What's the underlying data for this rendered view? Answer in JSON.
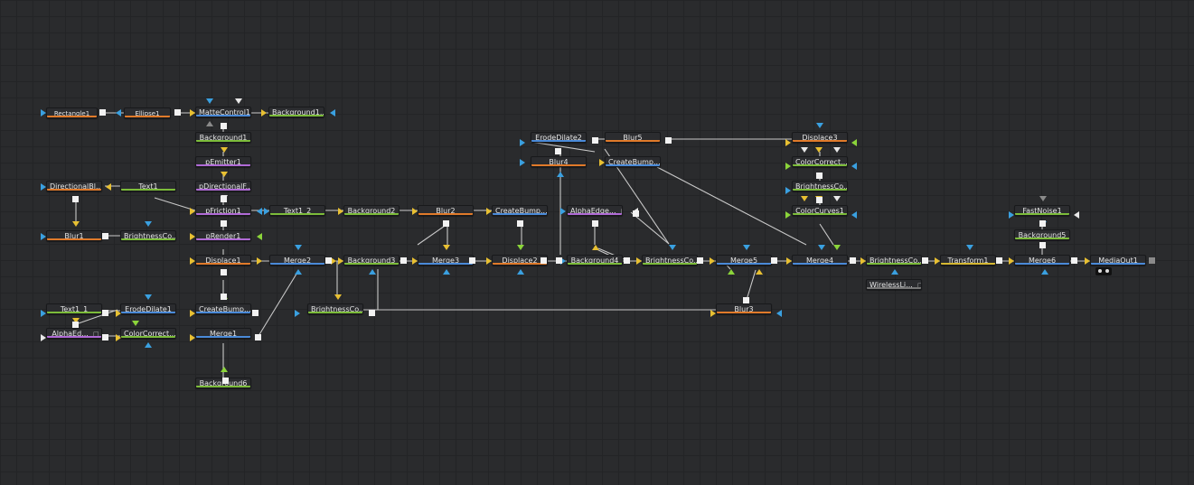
{
  "colors": {
    "background": "#2a2b2d",
    "wire": "#c9c9c9",
    "pin_blue": "#3aa0e0",
    "pin_yellow": "#e8c032",
    "pin_green": "#8bd43a",
    "pin_white": "#e8e8e8",
    "pin_grey": "#8a8a8a",
    "strip_orange": "#e07a2a",
    "strip_green": "#7cbc3a",
    "strip_purple": "#b06ad6",
    "strip_blue": "#4a8ad8",
    "strip_yellow": "#d6b832",
    "strip_red": "#c54a3a"
  },
  "nodes": [
    {
      "id": "rectangle1",
      "label": "Rectangle1",
      "type": "orange",
      "icon": ""
    },
    {
      "id": "ellipse1",
      "label": "Ellipse1",
      "type": "orange",
      "icon": ""
    },
    {
      "id": "mattecontrol1",
      "label": "MatteControl1",
      "type": "blue",
      "icon": ""
    },
    {
      "id": "background1_top",
      "label": "Background1...",
      "type": "green",
      "icon": ""
    },
    {
      "id": "background1",
      "label": "Background1",
      "type": "green",
      "icon": ""
    },
    {
      "id": "pemitter1",
      "label": "pEmitter1",
      "type": "purple",
      "icon": ""
    },
    {
      "id": "pdirectionalf",
      "label": "pDirectionalF...",
      "type": "purple",
      "icon": ""
    },
    {
      "id": "directionalbl",
      "label": "DirectionalBl...",
      "type": "orange",
      "icon": ""
    },
    {
      "id": "text1",
      "label": "Text1",
      "type": "green",
      "icon": ""
    },
    {
      "id": "pfriction1",
      "label": "pFriction1",
      "type": "purple",
      "icon": ""
    },
    {
      "id": "blur1",
      "label": "Blur1",
      "type": "orange",
      "icon": ""
    },
    {
      "id": "brightnessco1",
      "label": "BrightnessCo...",
      "type": "green",
      "icon": ""
    },
    {
      "id": "prender1",
      "label": "pRender1",
      "type": "purple",
      "icon": ""
    },
    {
      "id": "displace1",
      "label": "Displace1",
      "type": "orange",
      "icon": ""
    },
    {
      "id": "merge2",
      "label": "Merge2",
      "type": "blue",
      "icon": ""
    },
    {
      "id": "text1_2",
      "label": "Text1_2",
      "type": "green",
      "icon": ""
    },
    {
      "id": "background2",
      "label": "Background2",
      "type": "green",
      "icon": ""
    },
    {
      "id": "blur2",
      "label": "Blur2",
      "type": "orange",
      "icon": ""
    },
    {
      "id": "createbump1",
      "label": "CreateBump...",
      "type": "blue",
      "icon": ""
    },
    {
      "id": "background3",
      "label": "Background3",
      "type": "green",
      "icon": ""
    },
    {
      "id": "merge3",
      "label": "Merge3",
      "type": "blue",
      "icon": ""
    },
    {
      "id": "displace2",
      "label": "Displace2",
      "type": "orange",
      "icon": ""
    },
    {
      "id": "erodedilate2",
      "label": "ErodeDilate2",
      "type": "blue",
      "icon": ""
    },
    {
      "id": "blur4",
      "label": "Blur4",
      "type": "orange",
      "icon": ""
    },
    {
      "id": "blur5",
      "label": "Blur5",
      "type": "orange",
      "icon": ""
    },
    {
      "id": "createbump2",
      "label": "CreateBump...",
      "type": "blue",
      "icon": ""
    },
    {
      "id": "alphaedge1",
      "label": "AlphaEdge...",
      "type": "purple",
      "icon": "comment"
    },
    {
      "id": "background4",
      "label": "Background4",
      "type": "green",
      "icon": ""
    },
    {
      "id": "brightnessco2",
      "label": "BrightnessCo...",
      "type": "green",
      "icon": ""
    },
    {
      "id": "merge5",
      "label": "Merge5",
      "type": "blue",
      "icon": ""
    },
    {
      "id": "displace3",
      "label": "Displace3",
      "type": "orange",
      "icon": ""
    },
    {
      "id": "colorcorrect1",
      "label": "ColorCorrect...",
      "type": "green",
      "icon": ""
    },
    {
      "id": "brightnessco3",
      "label": "BrightnessCo...",
      "type": "green",
      "icon": ""
    },
    {
      "id": "colorcurves1",
      "label": "ColorCurves1",
      "type": "green",
      "icon": ""
    },
    {
      "id": "merge4",
      "label": "Merge4",
      "type": "blue",
      "icon": ""
    },
    {
      "id": "brightnessco4",
      "label": "BrightnessCo...",
      "type": "green",
      "icon": ""
    },
    {
      "id": "wirelessli",
      "label": "WirelessLi...",
      "type": "grey",
      "icon": "comment"
    },
    {
      "id": "transform1",
      "label": "Transform1",
      "type": "yellow",
      "icon": ""
    },
    {
      "id": "fastnoise1",
      "label": "FastNoise1",
      "type": "green",
      "icon": ""
    },
    {
      "id": "background5",
      "label": "Background5",
      "type": "green",
      "icon": ""
    },
    {
      "id": "merge6",
      "label": "Merge6",
      "type": "blue",
      "icon": ""
    },
    {
      "id": "mediaout1",
      "label": "MediaOut1",
      "type": "blue",
      "icon": ""
    },
    {
      "id": "text1_1",
      "label": "Text1_1",
      "type": "green",
      "icon": ""
    },
    {
      "id": "erodedilate1",
      "label": "ErodeDilate1",
      "type": "blue",
      "icon": ""
    },
    {
      "id": "createbump3",
      "label": "CreateBump...",
      "type": "blue",
      "icon": ""
    },
    {
      "id": "alphaedge2",
      "label": "AlphaEd...",
      "type": "purple",
      "icon": "comment"
    },
    {
      "id": "colorcorrect2",
      "label": "ColorCorrect...",
      "type": "green",
      "icon": ""
    },
    {
      "id": "merge1",
      "label": "Merge1",
      "type": "blue",
      "icon": ""
    },
    {
      "id": "brightnessco5",
      "label": "BrightnessCo...",
      "type": "green",
      "icon": ""
    },
    {
      "id": "blur3",
      "label": "Blur3",
      "type": "orange",
      "icon": ""
    },
    {
      "id": "background6",
      "label": "Background6",
      "type": "green",
      "icon": ""
    }
  ]
}
